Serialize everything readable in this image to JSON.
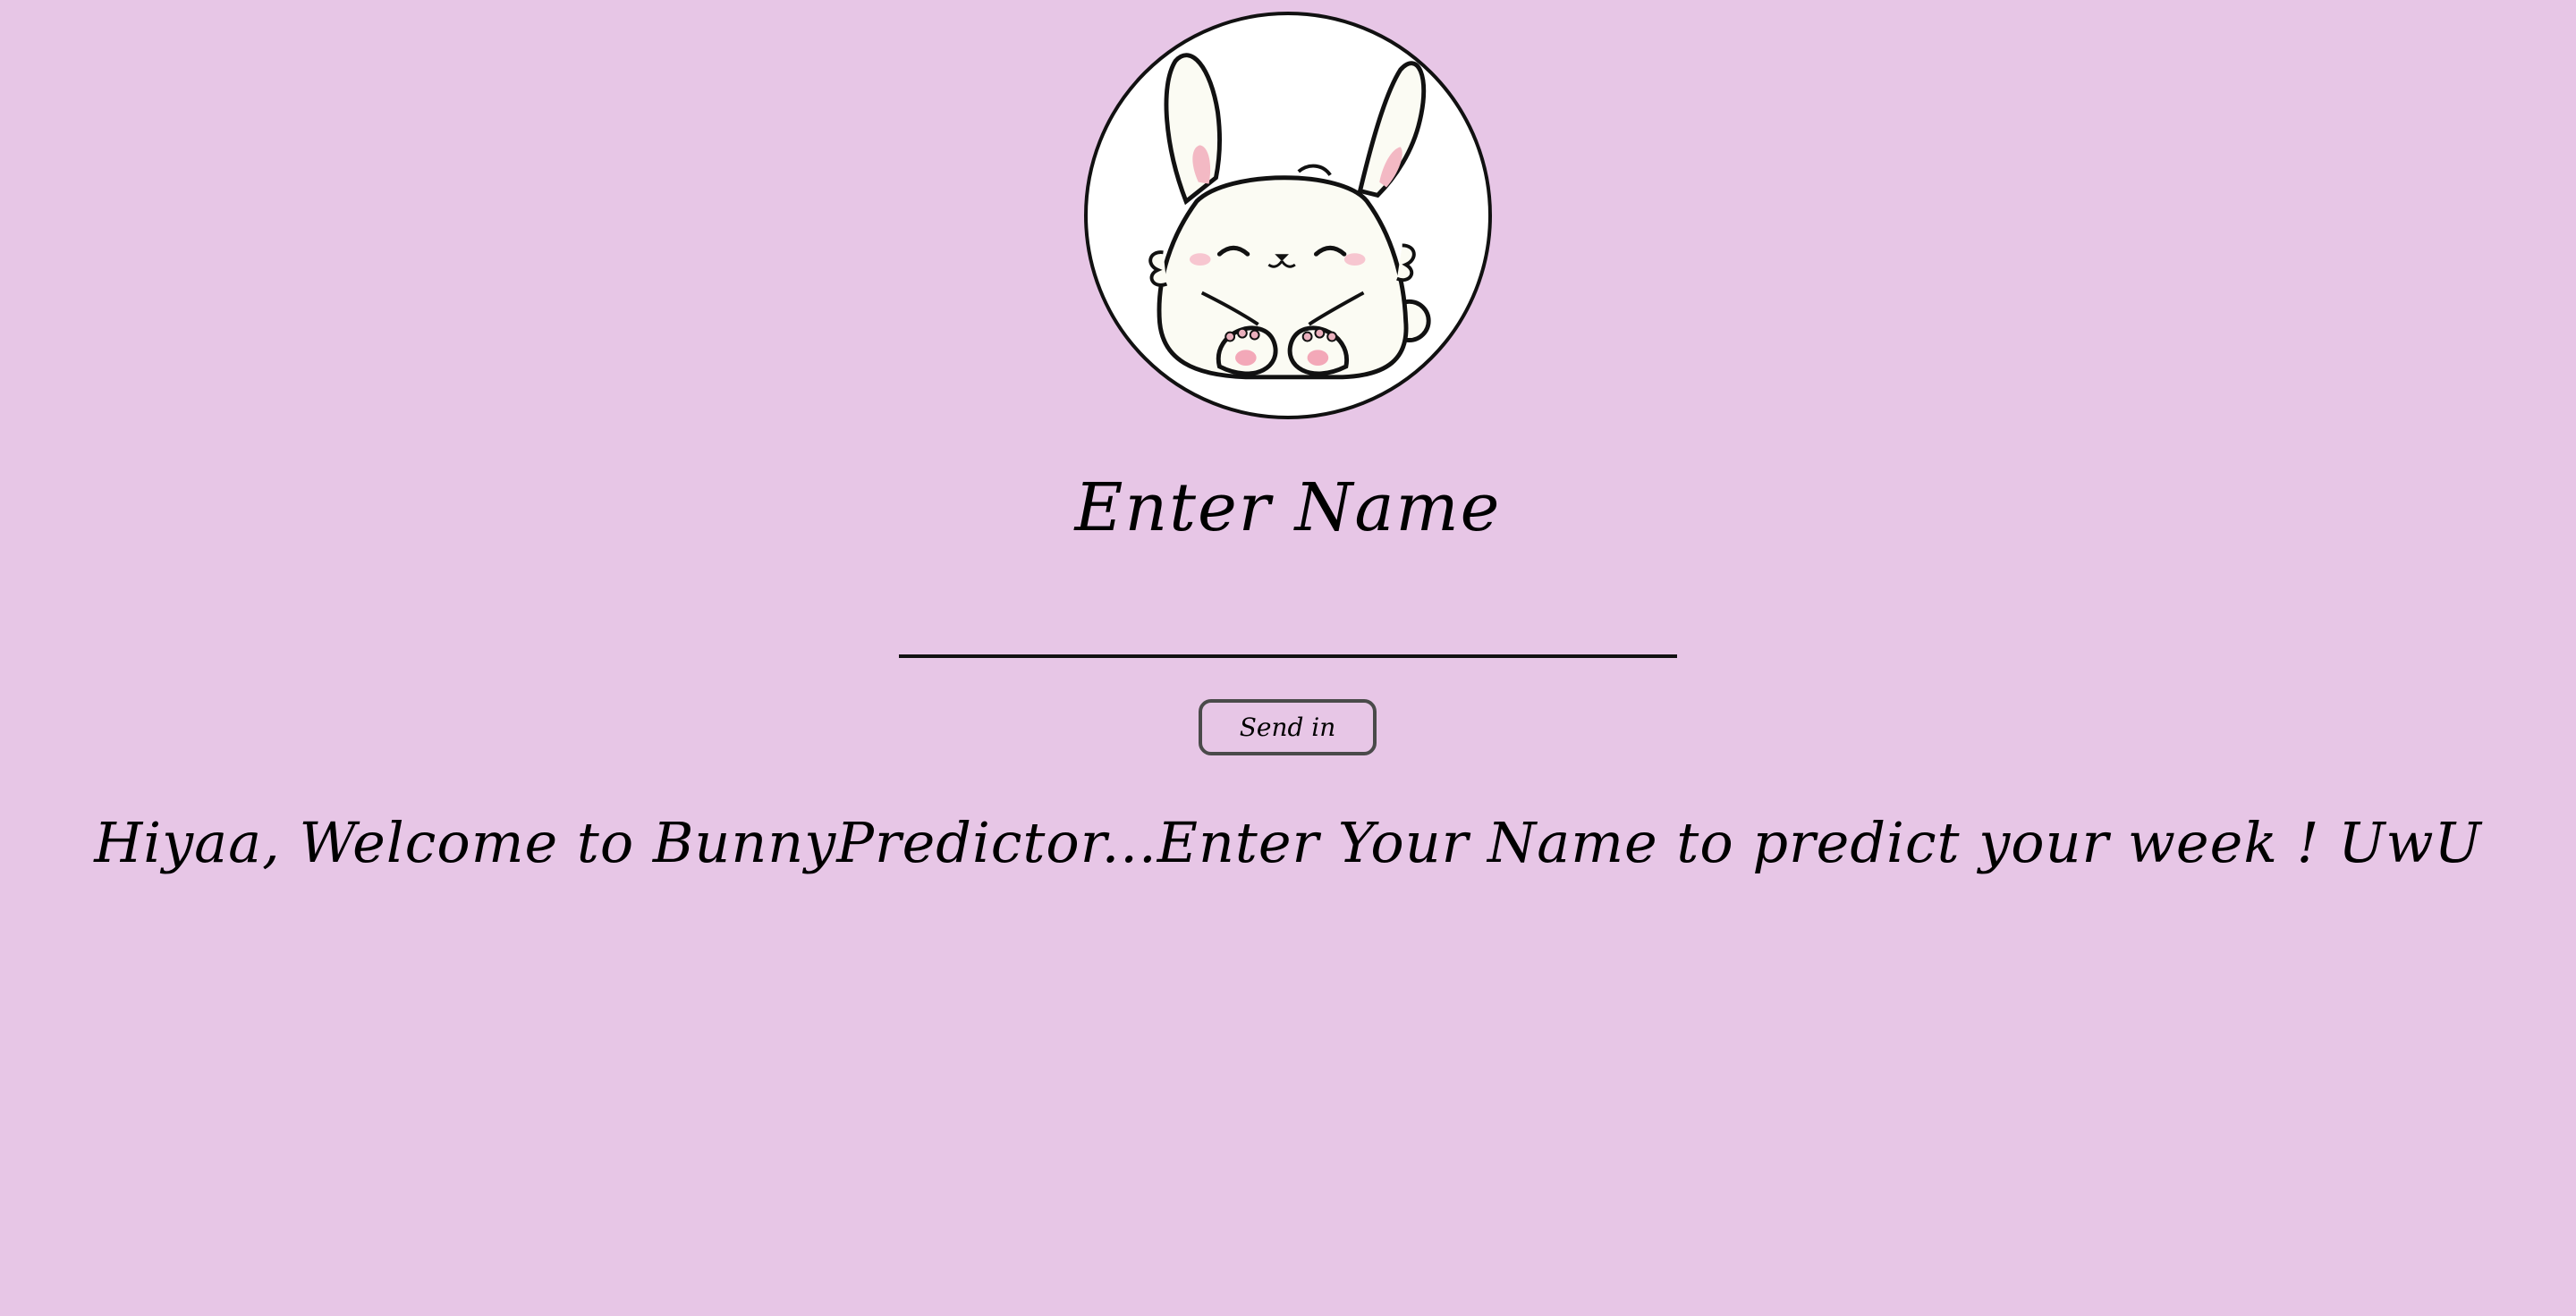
{
  "colors": {
    "background": "#e7c6e6",
    "avatar_background": "#ffffff",
    "text": "#000000"
  },
  "avatar": {
    "icon": "bunny-icon"
  },
  "form": {
    "title": "Enter Name",
    "name_input_value": "",
    "name_input_placeholder": "",
    "submit_label": "Send in"
  },
  "message": {
    "welcome_text": "Hiyaa, Welcome to BunnyPredictor...Enter Your Name to predict your week ! UwU"
  }
}
